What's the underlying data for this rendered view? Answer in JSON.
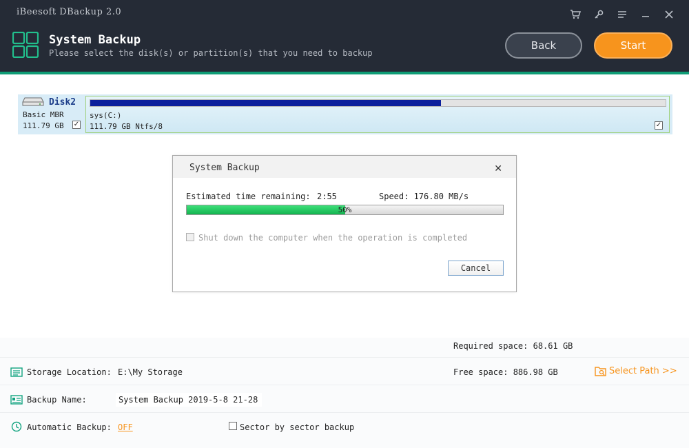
{
  "app": {
    "title": "iBeesoft DBackup 2.0",
    "window_icons": [
      "cart-icon",
      "key-icon",
      "menu-icon",
      "minimize-icon",
      "close-icon"
    ]
  },
  "header": {
    "page_title": "System Backup",
    "subtitle": "Please select the disk(s) or partition(s) that you need to backup",
    "back_label": "Back",
    "start_label": "Start",
    "accent_color": "#0f9d76",
    "start_color": "#f7941d"
  },
  "disk": {
    "name": "Disk2",
    "type": "Basic MBR",
    "size": "111.79 GB",
    "checked": true,
    "partition": {
      "name": "sys(C:)",
      "info": "111.79 GB Ntfs/8",
      "used_fraction": 0.61,
      "checked": true
    }
  },
  "dialog": {
    "title": "System Backup",
    "eta_label": "Estimated time remaining:",
    "eta_value": "2:55",
    "speed": "Speed: 176.80 MB/s",
    "progress_percent": 50,
    "progress_text": "50%",
    "shutdown_label": "Shut down the computer when the operation is completed",
    "shutdown_checked": false,
    "cancel_label": "Cancel"
  },
  "bottom": {
    "required_space": "Required space: 68.61 GB",
    "storage_label": "Storage Location:",
    "storage_value": "E:\\My Storage",
    "free_space": "Free space: 886.98 GB",
    "select_path_label": "Select Path >>",
    "backup_name_label": "Backup Name:",
    "backup_name_value": "System Backup 2019-5-8 21-28",
    "auto_backup_label": "Automatic Backup:",
    "auto_backup_value": "OFF",
    "sector_label": "Sector by sector backup",
    "sector_checked": false
  }
}
